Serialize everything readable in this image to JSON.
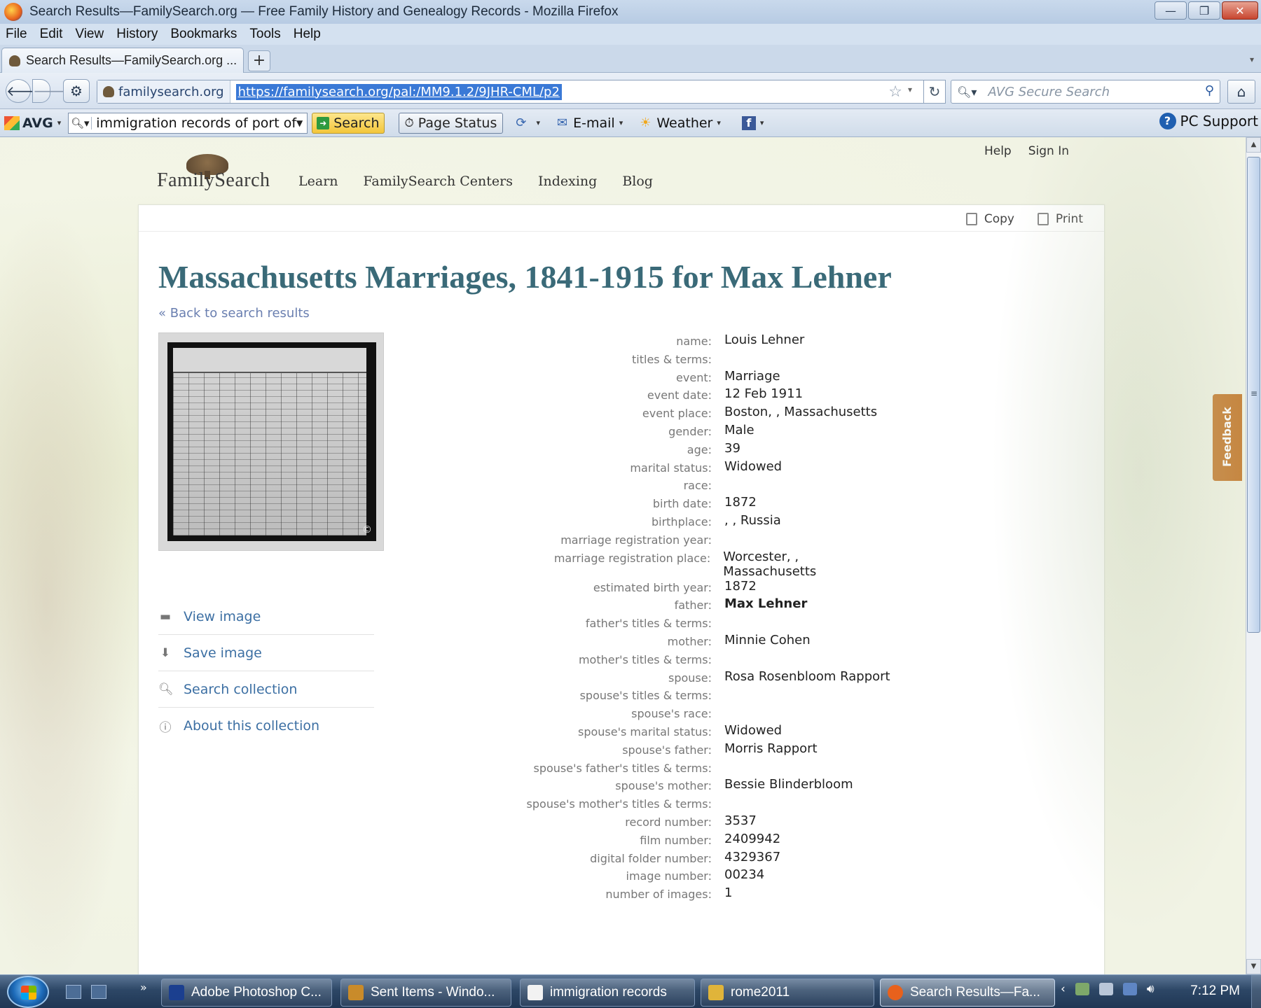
{
  "window": {
    "title": "Search Results—FamilySearch.org — Free Family History and Genealogy Records - Mozilla Firefox",
    "minimize": "—",
    "maximize": "❐",
    "close": "✕"
  },
  "menu": [
    "File",
    "Edit",
    "View",
    "History",
    "Bookmarks",
    "Tools",
    "Help"
  ],
  "tabs": [
    {
      "label": "Search Results—FamilySearch.org ..."
    }
  ],
  "new_tab": "+",
  "navbar": {
    "site_identity": "familysearch.org",
    "url": "https://familysearch.org/pal:/MM9.1.2/9JHR-CML/p2",
    "search_placeholder": "AVG Secure Search"
  },
  "avg_toolbar": {
    "brand": "AVG",
    "query": "immigration records of port of",
    "search_label": "Search",
    "page_status_label": "Page Status",
    "email_label": "E-mail",
    "weather_label": "Weather",
    "pc_support_label": "PC Support"
  },
  "site": {
    "help": "Help",
    "sign_in": "Sign In",
    "logo_text": "FamilySearch",
    "nav": [
      "Learn",
      "FamilySearch Centers",
      "Indexing",
      "Blog"
    ],
    "feedback": "Feedback"
  },
  "record": {
    "copy_label": "Copy",
    "print_label": "Print",
    "title": "Massachusetts Marriages, 1841-1915 for Max Lehner",
    "back_link": "« Back to search results",
    "actions": [
      {
        "label": "View image",
        "icon": "folder-icon"
      },
      {
        "label": "Save image",
        "icon": "download-icon"
      },
      {
        "label": "Search collection",
        "icon": "magnifier-icon"
      },
      {
        "label": "About this collection",
        "icon": "info-icon"
      }
    ],
    "fields": [
      {
        "label": "name:",
        "value": "Louis Lehner"
      },
      {
        "label": "titles & terms:",
        "value": ""
      },
      {
        "label": "event:",
        "value": "Marriage"
      },
      {
        "label": "event date:",
        "value": "12 Feb 1911"
      },
      {
        "label": "event place:",
        "value": "Boston, , Massachusetts"
      },
      {
        "label": "gender:",
        "value": "Male"
      },
      {
        "label": "age:",
        "value": "39"
      },
      {
        "label": "marital status:",
        "value": "Widowed"
      },
      {
        "label": "race:",
        "value": ""
      },
      {
        "label": "birth date:",
        "value": "1872"
      },
      {
        "label": "birthplace:",
        "value": ", , Russia"
      },
      {
        "label": "marriage registration year:",
        "value": ""
      },
      {
        "label": "marriage registration place:",
        "value": "Worcester, , Massachusetts"
      },
      {
        "label": "estimated birth year:",
        "value": "1872"
      },
      {
        "label": "father:",
        "value": "Max Lehner",
        "bold": true
      },
      {
        "label": "father's titles & terms:",
        "value": ""
      },
      {
        "label": "mother:",
        "value": "Minnie Cohen"
      },
      {
        "label": "mother's titles & terms:",
        "value": ""
      },
      {
        "label": "spouse:",
        "value": "Rosa Rosenbloom Rapport"
      },
      {
        "label": "spouse's titles & terms:",
        "value": ""
      },
      {
        "label": "spouse's race:",
        "value": ""
      },
      {
        "label": "spouse's marital status:",
        "value": "Widowed"
      },
      {
        "label": "spouse's father:",
        "value": "Morris Rapport"
      },
      {
        "label": "spouse's father's titles & terms:",
        "value": ""
      },
      {
        "label": "spouse's mother:",
        "value": "Bessie Blinderbloom"
      },
      {
        "label": "spouse's mother's titles & terms:",
        "value": ""
      },
      {
        "label": "record number:",
        "value": "3537"
      },
      {
        "label": "film number:",
        "value": "2409942"
      },
      {
        "label": "digital folder number:",
        "value": "4329367"
      },
      {
        "label": "image number:",
        "value": "00234"
      },
      {
        "label": "number of images:",
        "value": "1"
      }
    ]
  },
  "taskbar": {
    "tasks": [
      {
        "label": "Adobe Photoshop C...",
        "color": "#1b3f8f"
      },
      {
        "label": "Sent Items - Windo...",
        "color": "#c98b2a"
      },
      {
        "label": "immigration records",
        "color": "#f2f2f2"
      },
      {
        "label": "rome2011",
        "color": "#e0b43a"
      },
      {
        "label": "Search Results—Fa...",
        "color": "#e8611c",
        "active": true
      }
    ],
    "clock": "7:12 PM"
  },
  "colors": {
    "title_teal": "#3a6a78",
    "link_blue": "#3c6fa3",
    "feedback_orange": "#c57b2f"
  }
}
